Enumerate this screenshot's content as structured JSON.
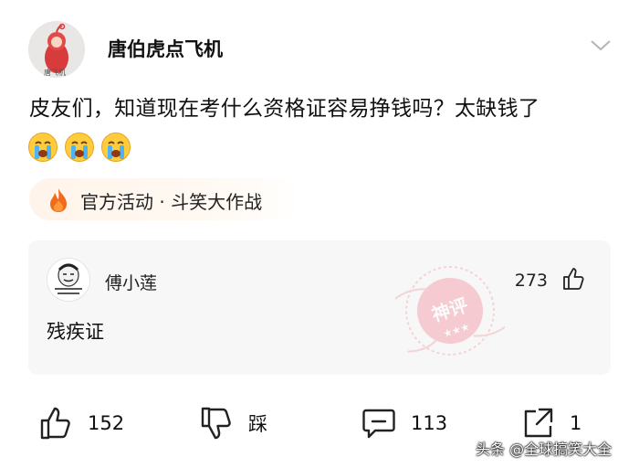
{
  "post": {
    "author": "唐伯虎点飞机",
    "avatar_caption": "唐飞机",
    "text": "皮友们，知道现在考什么资格证容易挣钱吗？太缺钱了",
    "emojis": [
      "crying-face-emoji",
      "crying-face-emoji",
      "crying-face-emoji"
    ],
    "topic_tag": "官方活动 · 斗笑大作战",
    "more_icon": "chevron-down-icon"
  },
  "top_comment": {
    "author": "傅小莲",
    "likes": "273",
    "text": "残疾证",
    "badge": "神评"
  },
  "actions": {
    "like_count": "152",
    "dislike_label": "踩",
    "comment_count": "113",
    "share_count": "1"
  },
  "watermark": "头条 @全球搞笑大全",
  "colors": {
    "accent_orange": "#f26a1b",
    "badge_pink": "#f0a8b0",
    "card_bg": "#f7f7f7"
  }
}
